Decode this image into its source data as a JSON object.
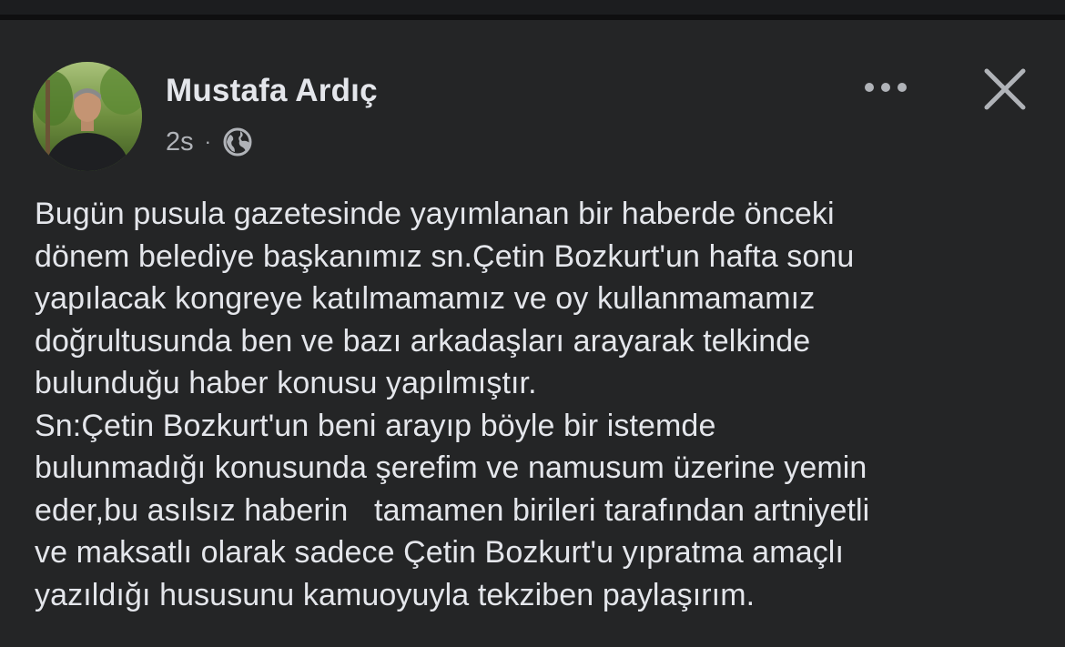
{
  "post": {
    "author": "Mustafa Ardıç",
    "timestamp": "2s",
    "separator": "·",
    "audience_icon": "globe-icon",
    "more_icon": "more-options-icon",
    "close_icon": "close-icon",
    "body": "Bugün pusula gazetesinde yayımlanan bir haberde önceki\ndönem belediye başkanımız sn.Çetin Bozkurt'un hafta sonu\nyapılacak kongreye katılmamamız ve oy kullanmamamız\ndoğrultusunda ben ve bazı arkadaşları arayarak telkinde\nbulunduğu haber konusu yapılmıştır.\nSn:Çetin Bozkurt'un beni arayıp böyle bir istemde\nbulunmadığı konusunda şerefim ve namusum üzerine yemin\neder,bu asılsız haberin   tamamen birileri tarafından artniyetli\nve maksatlı olarak sadece Çetin Bozkurt'u yıpratma amaçlı\nyazıldığı hususunu kamuoyuyla tekziben paylaşırım."
  },
  "colors": {
    "background": "#242526",
    "text_primary": "#e4e6eb",
    "text_secondary": "#b0b3b8"
  }
}
